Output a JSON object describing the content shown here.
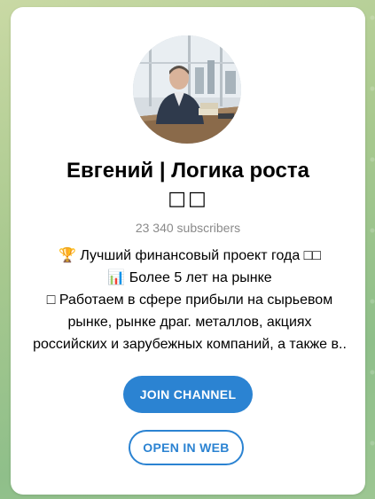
{
  "channel": {
    "title": "Евгений | Логика роста",
    "title_emoji": "□□",
    "subscribers": "23 340 subscribers"
  },
  "description": {
    "lines": [
      "🏆 Лучший финансовый проект года □□",
      "📊 Более 5 лет на рынке",
      "□ Работаем в сфере прибыли на сырьевом",
      "рынке, рынке драг. металлов, акциях",
      "российских и зарубежных компаний, а также в.."
    ]
  },
  "buttons": {
    "join_label": "JOIN CHANNEL",
    "web_label": "OPEN IN WEB"
  },
  "colors": {
    "accent": "#2b83d2",
    "card": "#ffffff",
    "muted_text": "#8a8a8a"
  },
  "icons": {
    "avatar": "channel-avatar-photo"
  }
}
